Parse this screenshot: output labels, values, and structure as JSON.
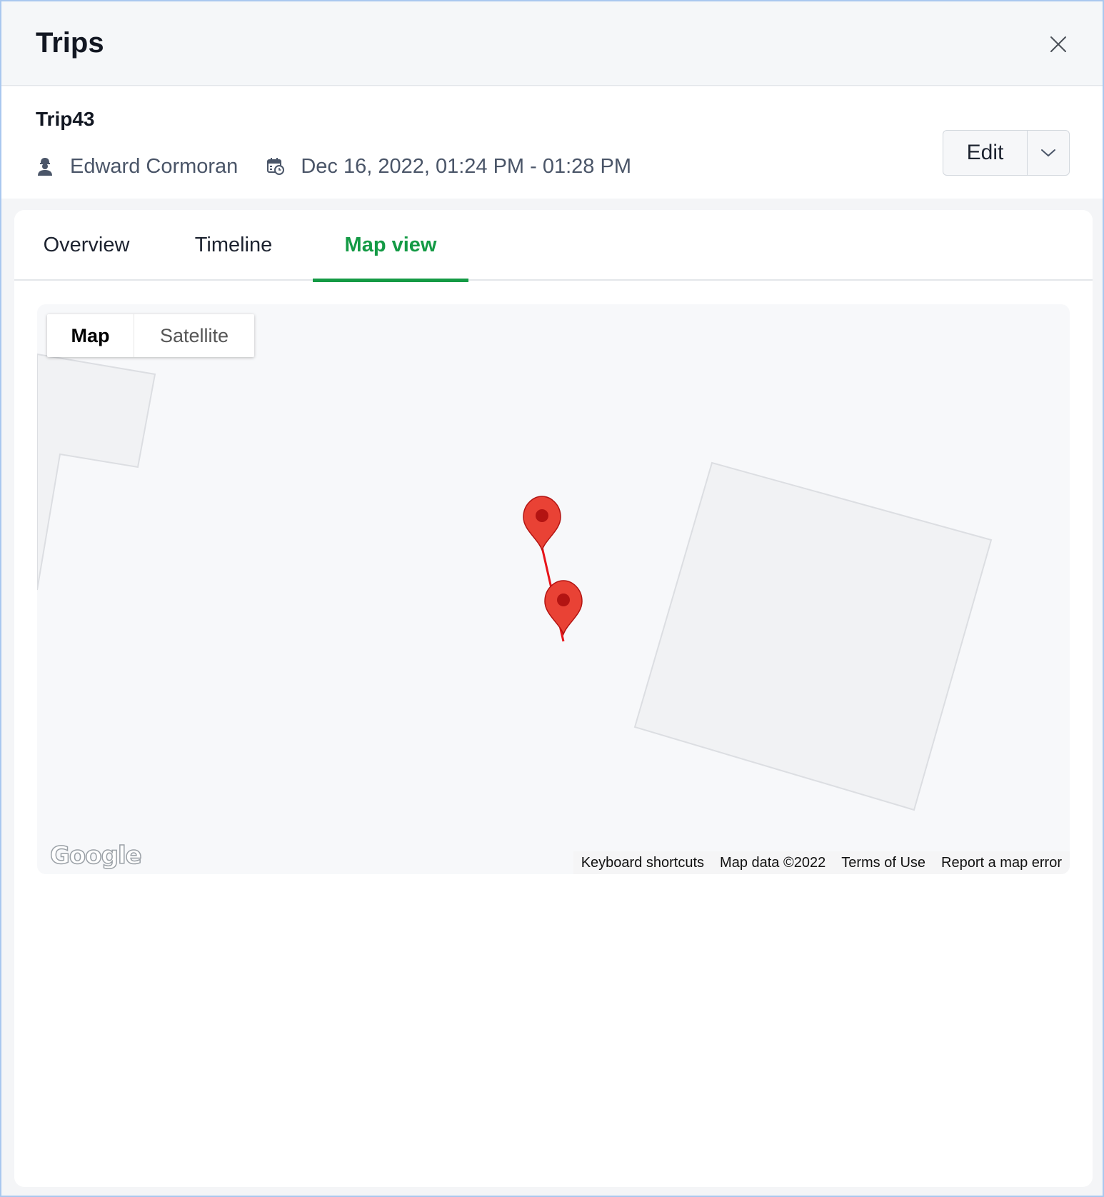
{
  "modal": {
    "title": "Trips",
    "close_icon": "close-icon"
  },
  "trip": {
    "name": "Trip43",
    "driver": "Edward Cormoran",
    "driver_icon": "user-icon",
    "time_range": "Dec 16, 2022, 01:24 PM - 01:28 PM",
    "time_icon": "calendar-clock-icon"
  },
  "actions": {
    "edit_label": "Edit",
    "dropdown_icon": "chevron-down-icon"
  },
  "tabs": [
    {
      "label": "Overview",
      "active": false
    },
    {
      "label": "Timeline",
      "active": false
    },
    {
      "label": "Map view",
      "active": true
    }
  ],
  "map": {
    "type_control": [
      {
        "label": "Map",
        "selected": true
      },
      {
        "label": "Satellite",
        "selected": false
      }
    ],
    "logo": "Google",
    "attribution": [
      "Keyboard shortcuts",
      "Map data ©2022",
      "Terms of Use",
      "Report a map error"
    ],
    "marker_color": "#e94235",
    "route_color": "#e8141a"
  },
  "colors": {
    "accent": "#149a45",
    "frame_border": "#a9c8ef"
  }
}
